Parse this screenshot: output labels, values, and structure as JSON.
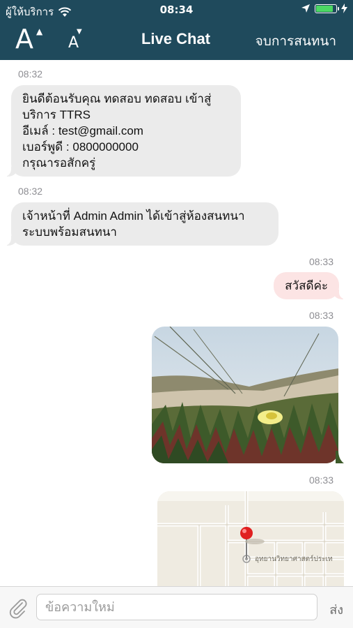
{
  "status_bar": {
    "carrier": "ผู้ให้บริการ",
    "time": "08:34"
  },
  "nav": {
    "font_increase_letter": "A",
    "font_decrease_letter": "A",
    "title": "Live Chat",
    "end_chat_label": "จบการสนทนา"
  },
  "messages": [
    {
      "time": "08:32",
      "direction": "incoming",
      "lines": [
        "ยินดีต้อนรับคุณ ทดสอบ ทดสอบ เข้าสู่",
        "บริการ TTRS",
        "อีเมล์ : test@gmail.com",
        "เบอร์พูดี : 0800000000",
        "กรุณารอสักครู่"
      ]
    },
    {
      "time": "08:32",
      "direction": "incoming",
      "lines": [
        "เจ้าหน้าที่ Admin Admin ได้เข้าสู่ห้องสนทนา",
        "ระบบพร้อมสนทนา"
      ]
    },
    {
      "time": "08:33",
      "direction": "outgoing",
      "text": "สวัสดีค่ะ"
    },
    {
      "time": "08:33",
      "direction": "outgoing",
      "type": "image"
    },
    {
      "time": "08:33",
      "direction": "outgoing",
      "type": "map",
      "map_label": "อุทยานวิทยาศาสตร์ประเท"
    }
  ],
  "input": {
    "placeholder": "ข้อความใหม่",
    "value": "",
    "send_label": "ส่ง"
  },
  "colors": {
    "header": "#1f4a5c",
    "incoming_bubble": "#ebebeb",
    "outgoing_bubble": "#fce4e4",
    "battery": "#4cd964"
  }
}
